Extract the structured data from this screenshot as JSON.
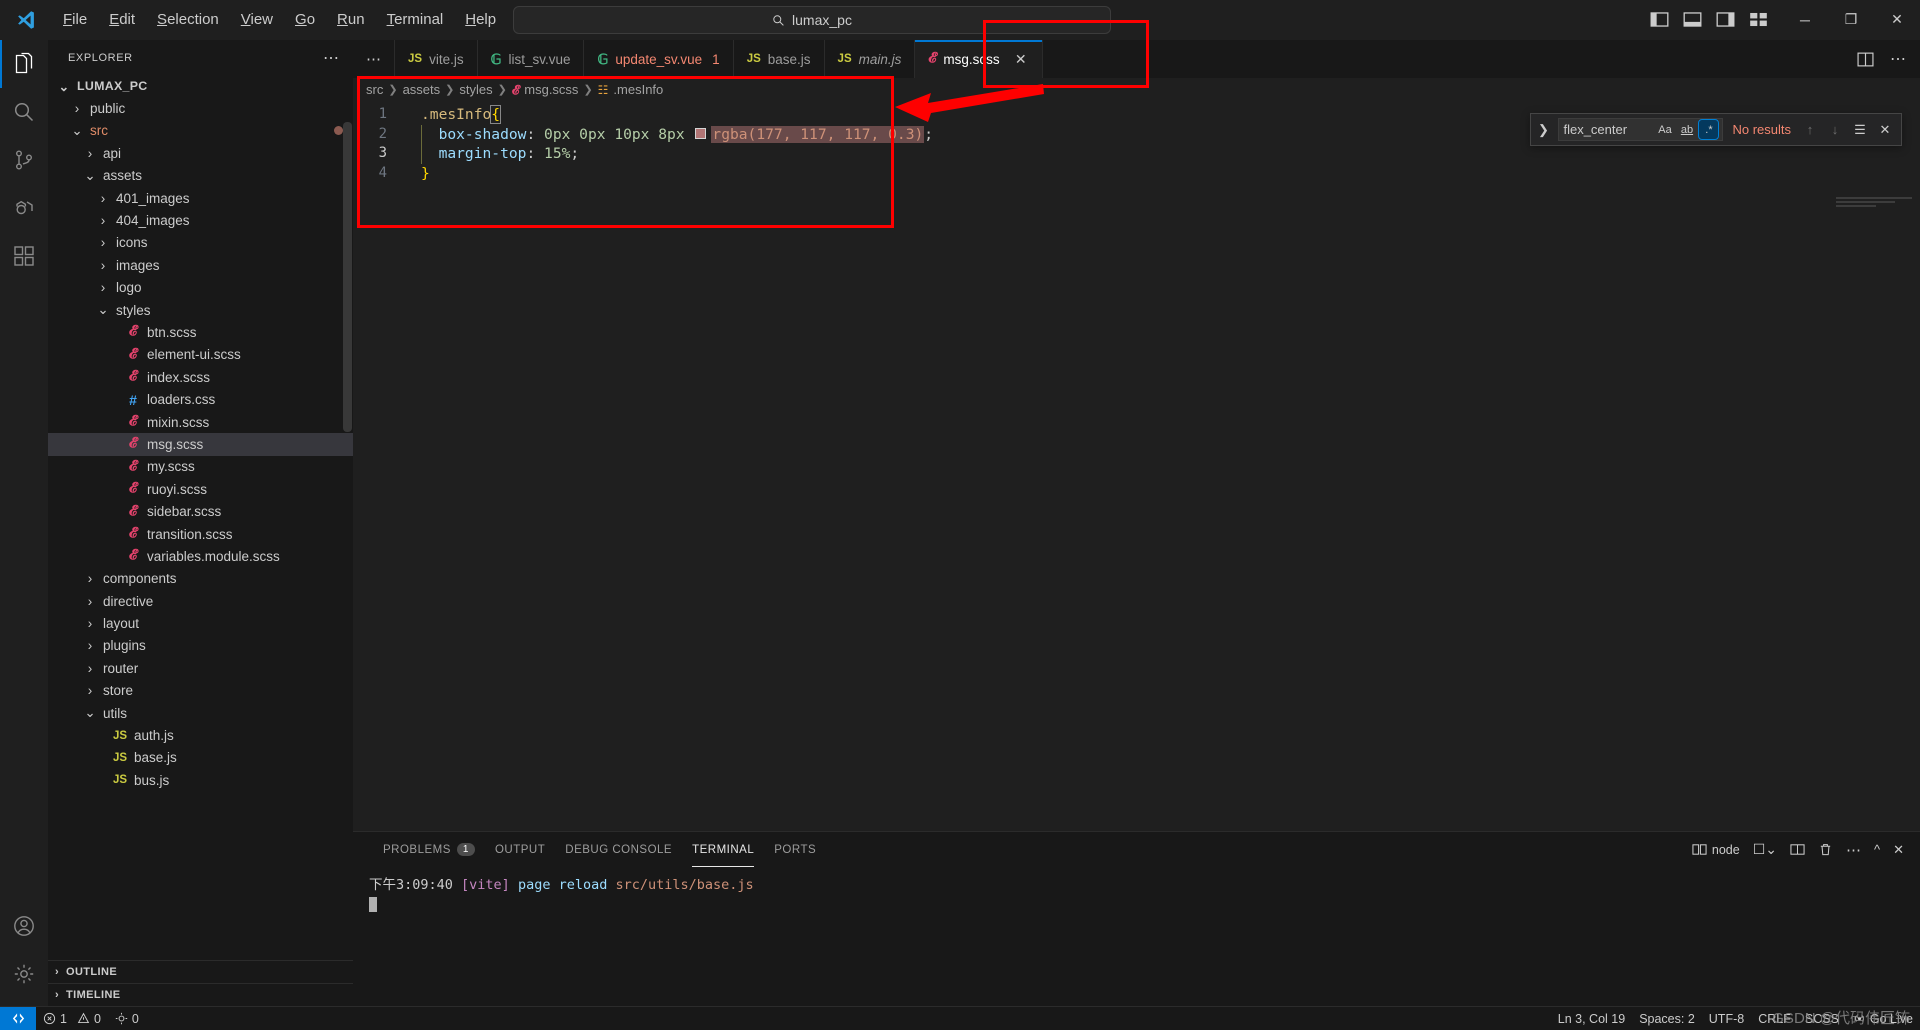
{
  "titlebar": {
    "logo_icon": "vscode-logo-icon",
    "menu": [
      {
        "label": "File",
        "mnemonic": "F"
      },
      {
        "label": "Edit",
        "mnemonic": "E"
      },
      {
        "label": "Selection",
        "mnemonic": "S"
      },
      {
        "label": "View",
        "mnemonic": "V"
      },
      {
        "label": "Go",
        "mnemonic": "G"
      },
      {
        "label": "Run",
        "mnemonic": "R"
      },
      {
        "label": "Terminal",
        "mnemonic": "T"
      },
      {
        "label": "Help",
        "mnemonic": "H"
      }
    ],
    "nav": {
      "back_icon": "arrow-left-icon",
      "forward_icon": "arrow-right-icon"
    },
    "quickopen": {
      "value": "lumax_pc",
      "icon": "search-icon"
    },
    "layout_icons": [
      "toggle-primary-sidebar-icon",
      "toggle-panel-icon",
      "toggle-secondary-sidebar-icon",
      "customize-layout-icon"
    ],
    "window_controls": {
      "minimize": "─",
      "maximize": "❐",
      "close": "✕"
    }
  },
  "activitybar": {
    "items": [
      {
        "name": "explorer",
        "icon": "files-icon",
        "active": true
      },
      {
        "name": "search",
        "icon": "search-icon",
        "active": false
      },
      {
        "name": "source-control",
        "icon": "source-control-icon",
        "active": false
      },
      {
        "name": "run-and-debug",
        "icon": "debug-icon",
        "active": false
      },
      {
        "name": "extensions",
        "icon": "extensions-icon",
        "active": false
      }
    ],
    "bottom": [
      {
        "name": "accounts",
        "icon": "account-icon"
      },
      {
        "name": "manage",
        "icon": "gear-icon"
      }
    ]
  },
  "sidebar": {
    "title": "EXPLORER",
    "more_actions": "⋯",
    "root": {
      "label": "LUMAX_PC",
      "expanded": true
    },
    "tree": [
      {
        "label": "public",
        "type": "folder",
        "depth": 1,
        "expanded": false
      },
      {
        "label": "src",
        "type": "folder",
        "depth": 1,
        "expanded": true,
        "modified": true,
        "dirty": true
      },
      {
        "label": "api",
        "type": "folder",
        "depth": 2,
        "expanded": false
      },
      {
        "label": "assets",
        "type": "folder",
        "depth": 2,
        "expanded": true
      },
      {
        "label": "401_images",
        "type": "folder",
        "depth": 3,
        "expanded": false
      },
      {
        "label": "404_images",
        "type": "folder",
        "depth": 3,
        "expanded": false
      },
      {
        "label": "icons",
        "type": "folder",
        "depth": 3,
        "expanded": false
      },
      {
        "label": "images",
        "type": "folder",
        "depth": 3,
        "expanded": false
      },
      {
        "label": "logo",
        "type": "folder",
        "depth": 3,
        "expanded": false
      },
      {
        "label": "styles",
        "type": "folder",
        "depth": 3,
        "expanded": true
      },
      {
        "label": "btn.scss",
        "type": "scss",
        "depth": 4
      },
      {
        "label": "element-ui.scss",
        "type": "scss",
        "depth": 4
      },
      {
        "label": "index.scss",
        "type": "scss",
        "depth": 4
      },
      {
        "label": "loaders.css",
        "type": "css",
        "depth": 4
      },
      {
        "label": "mixin.scss",
        "type": "scss",
        "depth": 4
      },
      {
        "label": "msg.scss",
        "type": "scss",
        "depth": 4,
        "selected": true
      },
      {
        "label": "my.scss",
        "type": "scss",
        "depth": 4
      },
      {
        "label": "ruoyi.scss",
        "type": "scss",
        "depth": 4
      },
      {
        "label": "sidebar.scss",
        "type": "scss",
        "depth": 4
      },
      {
        "label": "transition.scss",
        "type": "scss",
        "depth": 4
      },
      {
        "label": "variables.module.scss",
        "type": "scss",
        "depth": 4
      },
      {
        "label": "components",
        "type": "folder",
        "depth": 2,
        "expanded": false
      },
      {
        "label": "directive",
        "type": "folder",
        "depth": 2,
        "expanded": false
      },
      {
        "label": "layout",
        "type": "folder",
        "depth": 2,
        "expanded": false
      },
      {
        "label": "plugins",
        "type": "folder",
        "depth": 2,
        "expanded": false
      },
      {
        "label": "router",
        "type": "folder",
        "depth": 2,
        "expanded": false
      },
      {
        "label": "store",
        "type": "folder",
        "depth": 2,
        "expanded": false
      },
      {
        "label": "utils",
        "type": "folder",
        "depth": 2,
        "expanded": true
      },
      {
        "label": "auth.js",
        "type": "js",
        "depth": 3
      },
      {
        "label": "base.js",
        "type": "js",
        "depth": 3
      },
      {
        "label": "bus.js",
        "type": "js",
        "depth": 3
      }
    ],
    "sections": [
      {
        "label": "OUTLINE",
        "expanded": false
      },
      {
        "label": "TIMELINE",
        "expanded": false
      }
    ]
  },
  "editor": {
    "overflow_tabs": "⋯",
    "tabs": [
      {
        "label": "vite.js",
        "icon": "js-icon",
        "active": false,
        "italic": false
      },
      {
        "label": "list_sv.vue",
        "icon": "vue-icon",
        "active": false,
        "italic": false
      },
      {
        "label": "update_sv.vue",
        "icon": "vue-icon",
        "active": false,
        "italic": false,
        "error": true,
        "error_count": "1"
      },
      {
        "label": "base.js",
        "icon": "js-icon",
        "active": false,
        "italic": false
      },
      {
        "label": "main.js",
        "icon": "js-icon",
        "active": false,
        "italic": true
      },
      {
        "label": "msg.scss",
        "icon": "scss-icon",
        "active": true,
        "italic": false,
        "close": "✕"
      }
    ],
    "tab_actions": [
      "split-editor-icon",
      "more-actions-icon"
    ],
    "breadcrumb": [
      "src",
      "assets",
      "styles",
      "msg.scss",
      ".mesInfo"
    ],
    "breadcrumb_icons": {
      "file": "scss-icon",
      "symbol": "css-symbol-icon"
    },
    "lines": [
      {
        "n": "1",
        "tokens": [
          {
            "t": ".mesInfo",
            "c": "sel"
          },
          {
            "t": "{",
            "c": "brace-box"
          }
        ]
      },
      {
        "n": "2",
        "tokens": [
          {
            "t": "box-shadow",
            "c": "prop"
          },
          {
            "t": ": ",
            "c": "punc"
          },
          {
            "t": "0px 0px 10px 8px ",
            "c": "num"
          },
          {
            "t": "swatch",
            "c": "color"
          },
          {
            "t": "rgba(177, 117, 117, 0.3)",
            "c": "rgba"
          },
          {
            "t": ";",
            "c": "punc"
          }
        ]
      },
      {
        "n": "3",
        "tokens": [
          {
            "t": "margin-top",
            "c": "prop"
          },
          {
            "t": ": ",
            "c": "punc"
          },
          {
            "t": "15%",
            "c": "num"
          },
          {
            "t": ";",
            "c": "punc"
          }
        ],
        "current": true
      },
      {
        "n": "4",
        "tokens": [
          {
            "t": "}",
            "c": "brace"
          }
        ]
      }
    ],
    "swatch_color": "#b17575"
  },
  "find": {
    "expand_icon": "chevron-right-icon",
    "value": "flex_center",
    "placeholder": "Find",
    "options": [
      {
        "name": "match-case",
        "label": "Aa",
        "on": false
      },
      {
        "name": "match-whole-word",
        "label": "ab",
        "on": false
      },
      {
        "name": "use-regex",
        "label": ".*",
        "on": true
      }
    ],
    "result_text": "No results",
    "buttons": [
      "previous-match-icon",
      "next-match-icon",
      "find-in-selection-icon",
      "close-icon"
    ]
  },
  "panel": {
    "tabs": [
      {
        "label": "PROBLEMS",
        "active": false,
        "badge": "1"
      },
      {
        "label": "OUTPUT",
        "active": false
      },
      {
        "label": "DEBUG CONSOLE",
        "active": false
      },
      {
        "label": "TERMINAL",
        "active": true
      },
      {
        "label": "PORTS",
        "active": false
      }
    ],
    "actions": {
      "split_terminal_icon": "split-terminal-icon",
      "shell_label": "node",
      "new_terminal_icon": "new-terminal-icon",
      "layout_icon": "terminal-layout-icon",
      "kill_icon": "trash-icon",
      "more_icon": "more-actions-icon",
      "maximize_icon": "chevron-up-icon",
      "close_icon": "close-icon"
    },
    "terminal_lines": [
      {
        "time": "下午3:09:40",
        "tag": "[vite]",
        "message": "page reload",
        "path": "src/utils/base.js"
      }
    ]
  },
  "statusbar": {
    "remote_icon": "remote-window-icon",
    "left": [
      {
        "name": "errors",
        "icon": "error-icon",
        "label": "1"
      },
      {
        "name": "warnings",
        "icon": "warning-icon",
        "label": "0"
      },
      {
        "name": "ports",
        "icon": "ports-icon",
        "label": "0"
      }
    ],
    "right": [
      {
        "name": "cursor-position",
        "label": "Ln 3, Col 19"
      },
      {
        "name": "indentation",
        "label": "Spaces: 2"
      },
      {
        "name": "encoding",
        "label": "UTF-8"
      },
      {
        "name": "eol",
        "label": "CRLF"
      },
      {
        "name": "language-mode",
        "label": "SCSS"
      },
      {
        "name": "go-live",
        "label": "Go Live",
        "icon": "broadcast-icon"
      }
    ]
  },
  "watermark": {
    "text": "GSDN @代码伟匠钸"
  },
  "annotations": {
    "code_box": {
      "color": "#fe0000"
    },
    "tab_box": {
      "color": "#fe0000"
    },
    "arrow": {
      "color": "#fe0000",
      "direction": "left"
    }
  }
}
